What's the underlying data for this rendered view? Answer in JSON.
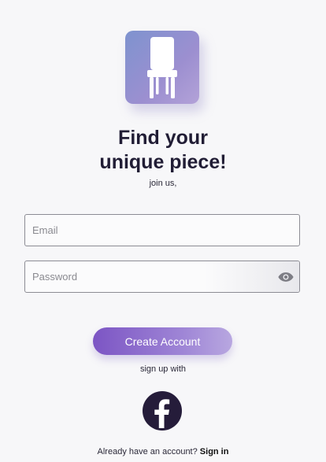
{
  "headline": {
    "line1": "Find your",
    "line2": "unique piece!"
  },
  "subtitle": "join us,",
  "form": {
    "email_placeholder": "Email",
    "password_placeholder": "Password"
  },
  "buttons": {
    "create_account": "Create Account"
  },
  "social": {
    "label": "sign up with",
    "provider_icon": "facebook-icon"
  },
  "footer": {
    "prompt": "Already have an account?",
    "signin_label": "Sign in"
  },
  "icons": {
    "logo": "chair-icon",
    "password_toggle": "eye-icon"
  },
  "colors": {
    "accent": "#7c55c4",
    "logo_tile": "#8f92d0",
    "facebook_circle": "#251c3a",
    "background": "#f7f7f9"
  }
}
